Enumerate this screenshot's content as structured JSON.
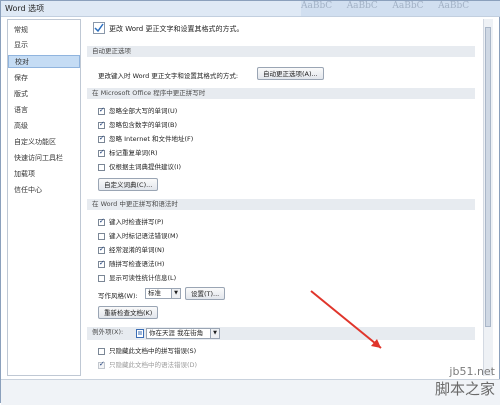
{
  "window": {
    "title": "Word 选项"
  },
  "ribbon_bleed": [
    "AaBbC",
    "AaBbC",
    "AaBbC",
    "AaBbC"
  ],
  "sidebar": {
    "items": [
      {
        "label": "常规"
      },
      {
        "label": "显示"
      },
      {
        "label": "校对",
        "active": true
      },
      {
        "label": "保存"
      },
      {
        "label": "版式"
      },
      {
        "label": "语言"
      },
      {
        "label": "高级"
      },
      {
        "label": "自定义功能区"
      },
      {
        "label": "快速访问工具栏"
      },
      {
        "label": "加载项"
      },
      {
        "label": "信任中心"
      }
    ]
  },
  "header": {
    "description": "更改 Word 更正文字和设置其格式的方式。"
  },
  "autocorrect": {
    "section_title": "自动更正选项",
    "description": "更改键入时 Word 更正文字和设置其格式的方式:",
    "button_label": "自动更正选项(A)..."
  },
  "office_proofing": {
    "section_title": "在 Microsoft Office 程序中更正拼写时",
    "options": [
      {
        "label": "忽略全部大写的单词(U)",
        "checked": true
      },
      {
        "label": "忽略包含数字的单词(B)",
        "checked": true
      },
      {
        "label": "忽略 Internet 和文件地址(F)",
        "checked": true
      },
      {
        "label": "标记重复单词(R)",
        "checked": true
      },
      {
        "label": "仅根据主词典提供建议(I)",
        "checked": false
      }
    ],
    "custom_dict_button": "自定义词典(C)..."
  },
  "word_proofing": {
    "section_title": "在 Word 中更正拼写和语法时",
    "options": [
      {
        "label": "键入时检查拼写(P)",
        "checked": true
      },
      {
        "label": "键入时标记语法错误(M)",
        "checked": false
      },
      {
        "label": "经常混淆的单词(N)",
        "checked": true
      },
      {
        "label": "随拼写检查语法(H)",
        "checked": true
      },
      {
        "label": "显示可读性统计信息(L)",
        "checked": false
      }
    ],
    "writing_style_label": "写作风格(W):",
    "writing_style_value": "标准",
    "settings_button": "设置(T)...",
    "recheck_button": "重新检查文档(K)"
  },
  "exceptions": {
    "label": "例外项(X):",
    "document_value": "你在天涯 我在街角",
    "options": [
      {
        "label": "只隐藏此文档中的拼写错误(S)",
        "checked": false,
        "disabled": false
      },
      {
        "label": "只隐藏此文档中的语法错误(D)",
        "checked": true,
        "disabled": true
      }
    ]
  },
  "watermark": {
    "url": "jb51.net",
    "brand": "脚本之家"
  },
  "colors": {
    "accent": "#c5dcf4",
    "section_bg": "#e7ebf0",
    "annotation_arrow": "#e0352b"
  }
}
